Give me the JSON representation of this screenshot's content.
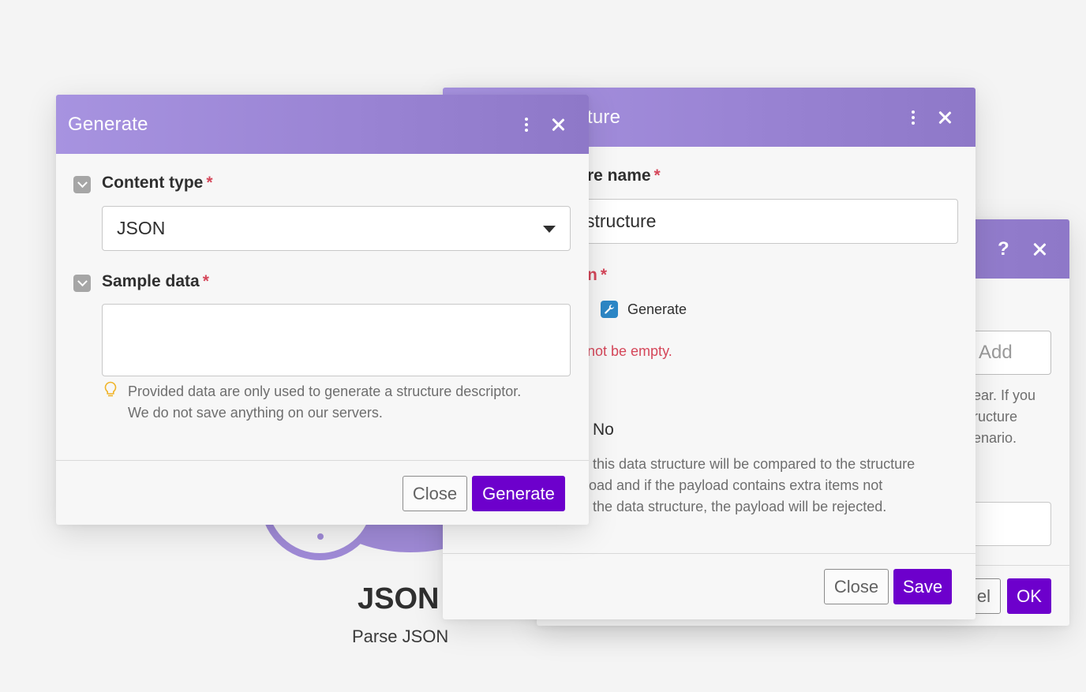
{
  "colors": {
    "header_gradient_start": "#a793e0",
    "header_gradient_end": "#8e78c8",
    "primary_button": "#6d00cc",
    "error_red": "#d5475a",
    "panel_bg": "#f7f7f7"
  },
  "background_module": {
    "title": "JSON",
    "subtitle": "Parse JSON"
  },
  "back_dialog": {
    "help_icon": "?",
    "add_button": "Add",
    "help_text_lines": [
      "ear. If you",
      "ructure",
      "enario."
    ],
    "cancel_button_partial": "el",
    "ok_button": "OK"
  },
  "structure_dialog": {
    "title_partial": "ture",
    "name_label_partial": "re name",
    "name_value_partial": "structure",
    "spec_label_partial": "n",
    "generate_link": "Generate",
    "error_text_partial": "not be empty.",
    "strict_value": "No",
    "strict_help_lines": [
      "this data structure will be compared to the structure",
      "oad and if the payload contains extra items not",
      "the data structure, the payload will be rejected."
    ],
    "close_button": "Close",
    "save_button": "Save"
  },
  "generate_dialog": {
    "title": "Generate",
    "content_type_label": "Content type",
    "content_type_value": "JSON",
    "sample_data_label": "Sample data",
    "sample_data_value": "",
    "hint_line1": "Provided data are only used to generate a structure descriptor.",
    "hint_line2": "We do not save anything on our servers.",
    "close_button": "Close",
    "generate_button": "Generate"
  }
}
